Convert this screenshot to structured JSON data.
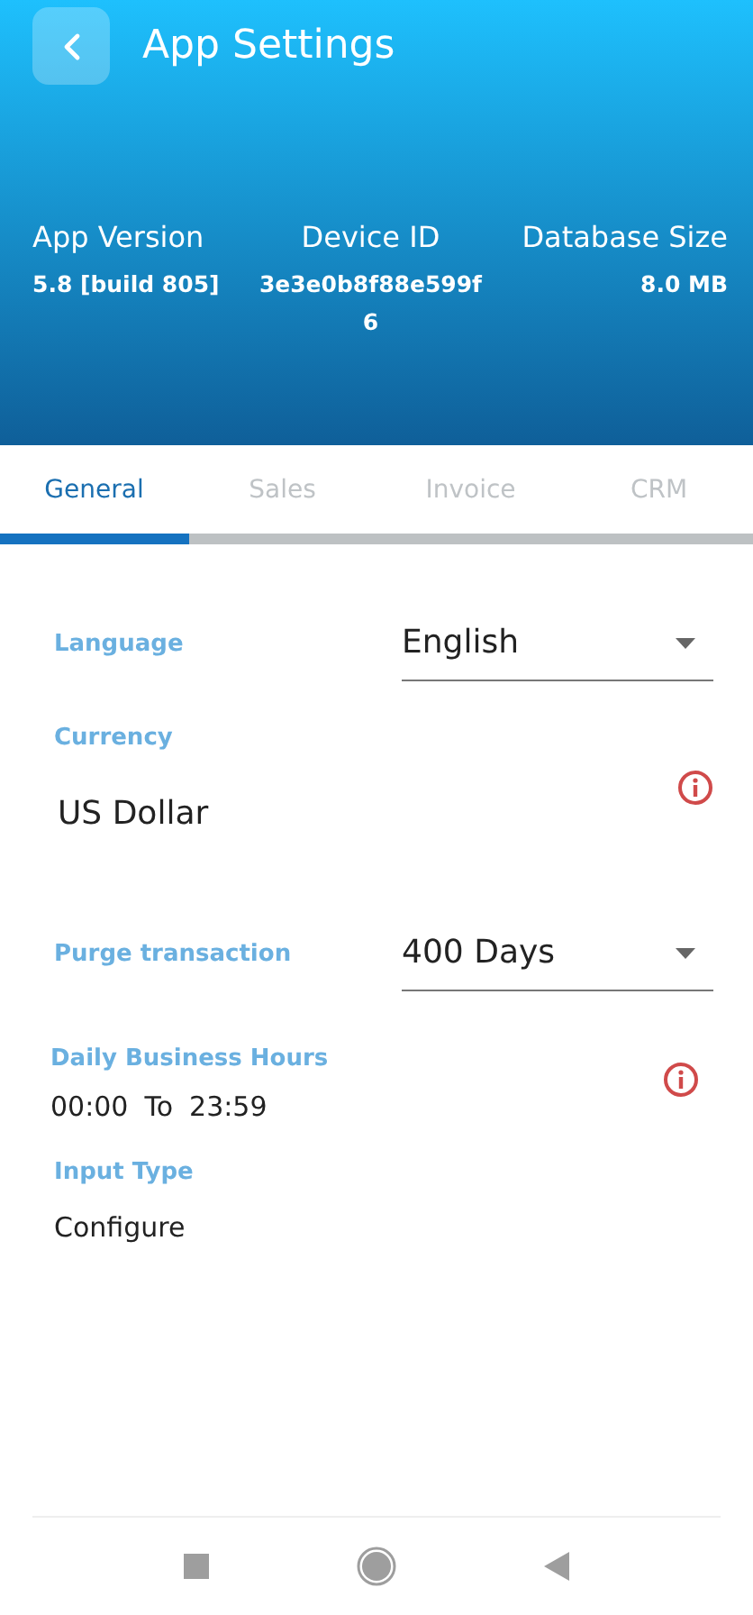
{
  "header": {
    "title": "App Settings",
    "stats": [
      {
        "label": "App Version",
        "value": "5.8 [build 805]"
      },
      {
        "label": "Device ID",
        "value": "3e3e0b8f88e599f6"
      },
      {
        "label": "Database Size",
        "value": "8.0 MB"
      }
    ]
  },
  "tabs": [
    {
      "label": "General",
      "selected": true
    },
    {
      "label": "Sales",
      "selected": false
    },
    {
      "label": "Invoice",
      "selected": false
    },
    {
      "label": "CRM",
      "selected": false
    }
  ],
  "settings": [
    {
      "kind": "select",
      "label": "Language",
      "value": "English"
    },
    {
      "kind": "value",
      "label": "Currency",
      "value": "US Dollar",
      "info": true
    },
    {
      "kind": "select",
      "label": "Purge transaction",
      "value": "400 Days"
    },
    {
      "kind": "hours",
      "label": "Daily Business Hours",
      "from": "00:00",
      "to_label": "To",
      "to": "23:59",
      "info": true
    },
    {
      "kind": "value",
      "label": "Input Type",
      "value": "Configure"
    }
  ]
}
